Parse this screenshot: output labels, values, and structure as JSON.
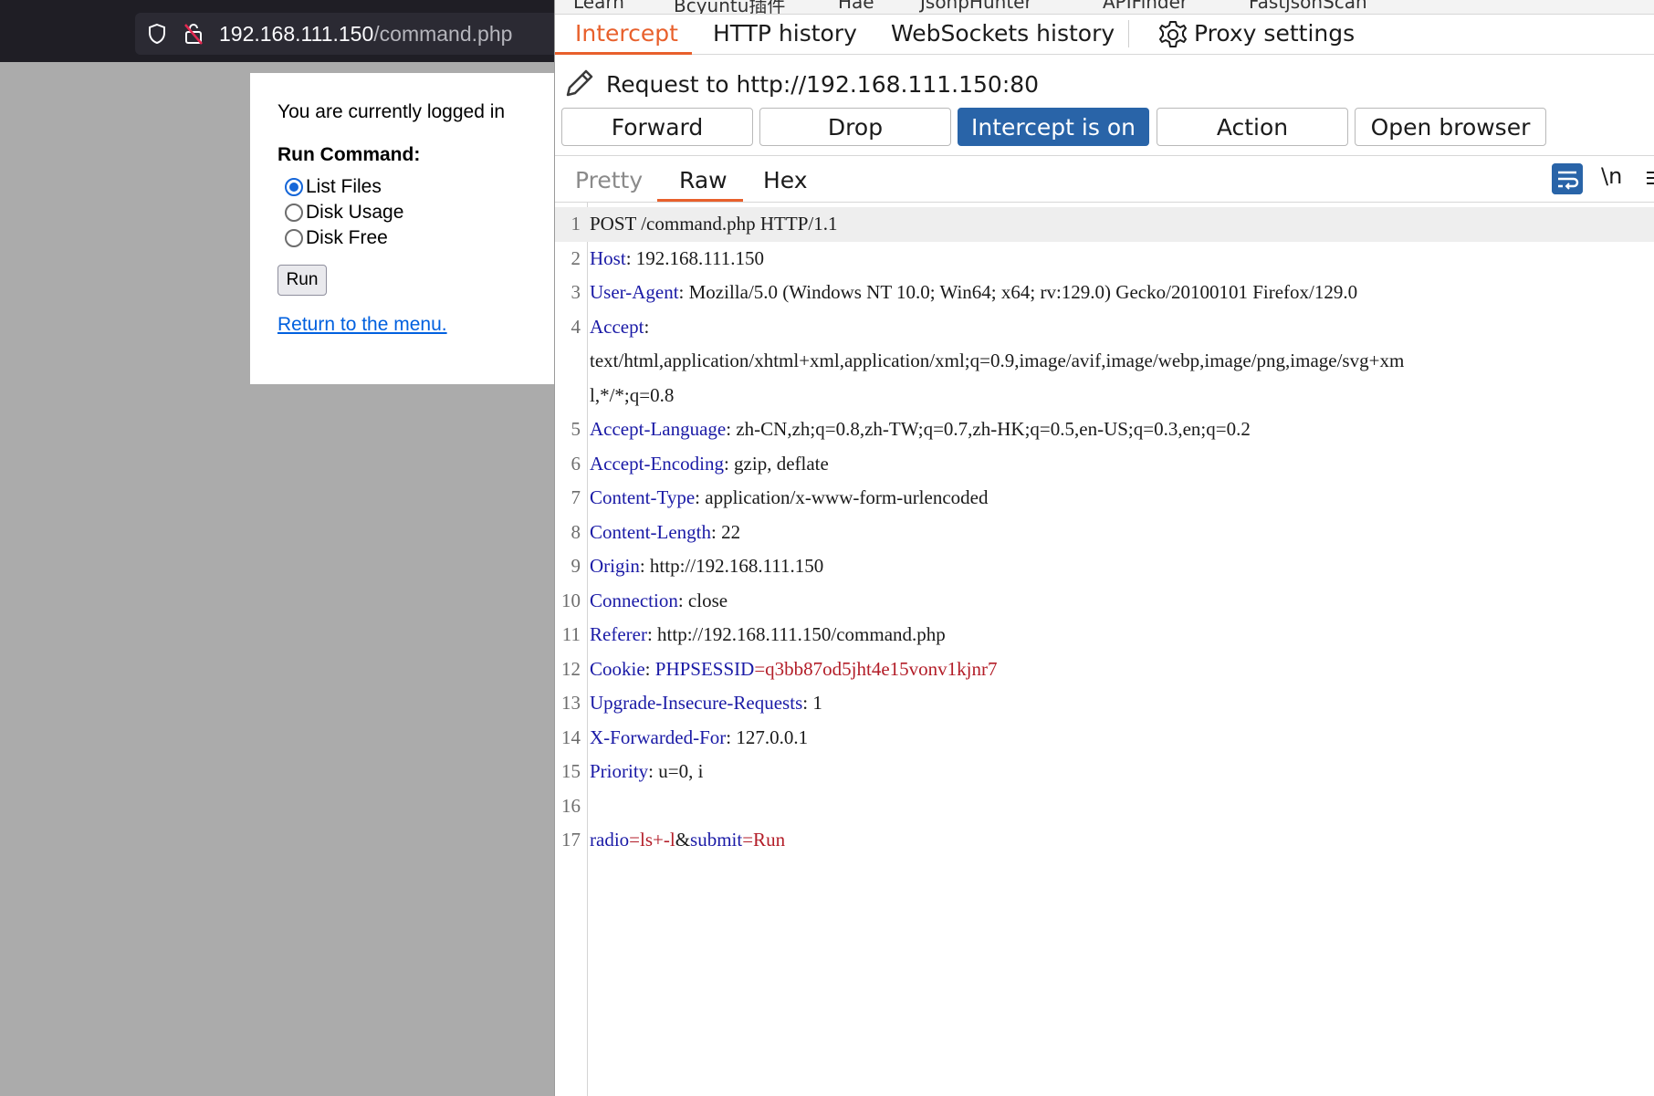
{
  "browser": {
    "url_host": "192.168.111.150",
    "url_path": "/command.php",
    "page": {
      "logged_in_text": "You are currently logged in",
      "run_command_heading": "Run Command:",
      "options": [
        {
          "label": "List Files",
          "selected": true
        },
        {
          "label": "Disk Usage",
          "selected": false
        },
        {
          "label": "Disk Free",
          "selected": false
        }
      ],
      "run_button": "Run",
      "return_link": "Return to the menu."
    }
  },
  "burp": {
    "top_strip": [
      "Learn",
      "Bcyuntu插件",
      "Hae",
      "JsonpHunter",
      "APIFinder",
      "FastjsonScan"
    ],
    "proxy_tabs": [
      "Intercept",
      "HTTP history",
      "WebSockets history",
      "Proxy settings"
    ],
    "active_proxy_tab": "Intercept",
    "request_title": "Request to http://192.168.111.150:80",
    "action_buttons": [
      "Forward",
      "Drop",
      "Intercept is on",
      "Action",
      "Open browser"
    ],
    "view_tabs": [
      "Pretty",
      "Raw",
      "Hex"
    ],
    "active_view_tab": "Raw",
    "newline_toggle": "\\n",
    "request_lines": [
      {
        "n": "1",
        "text": "POST /command.php HTTP/1.1"
      },
      {
        "n": "2",
        "key": "Host",
        "value": ": 192.168.111.150"
      },
      {
        "n": "3",
        "key": "User-Agent",
        "value": ": Mozilla/5.0 (Windows NT 10.0; Win64; x64; rv:129.0) Gecko/20100101 Firefox/129.0"
      },
      {
        "n": "4",
        "key": "Accept",
        "value": ":"
      },
      {
        "n": "",
        "text": "text/html,application/xhtml+xml,application/xml;q=0.9,image/avif,image/webp,image/png,image/svg+xm"
      },
      {
        "n": "",
        "text": "l,*/*;q=0.8"
      },
      {
        "n": "5",
        "key": "Accept-Language",
        "value": ": zh-CN,zh;q=0.8,zh-TW;q=0.7,zh-HK;q=0.5,en-US;q=0.3,en;q=0.2"
      },
      {
        "n": "6",
        "key": "Accept-Encoding",
        "value": ": gzip, deflate"
      },
      {
        "n": "7",
        "key": "Content-Type",
        "value": ": application/x-www-form-urlencoded"
      },
      {
        "n": "8",
        "key": "Content-Length",
        "value": ": 22"
      },
      {
        "n": "9",
        "key": "Origin",
        "value": ": http://192.168.111.150"
      },
      {
        "n": "10",
        "key": "Connection",
        "value": ": close"
      },
      {
        "n": "11",
        "key": "Referer",
        "value": ": http://192.168.111.150/command.php"
      },
      {
        "n": "12",
        "key": "Cookie",
        "value": ": ",
        "cookie_name": "PHPSESSID",
        "cookie_value": "=q3bb87od5jht4e15vonv1kjnr7"
      },
      {
        "n": "13",
        "key": "Upgrade-Insecure-Requests",
        "value": ": 1"
      },
      {
        "n": "14",
        "key": "X-Forwarded-For",
        "value": ": 127.0.0.1"
      },
      {
        "n": "15",
        "key": "Priority",
        "value": ": u=0, i"
      },
      {
        "n": "16",
        "text": ""
      },
      {
        "n": "17",
        "body": [
          {
            "k": "radio",
            "v": "=ls+-l"
          },
          {
            "k": "&",
            "v": ""
          },
          {
            "k": "submit",
            "v": "=Run"
          }
        ]
      }
    ]
  }
}
